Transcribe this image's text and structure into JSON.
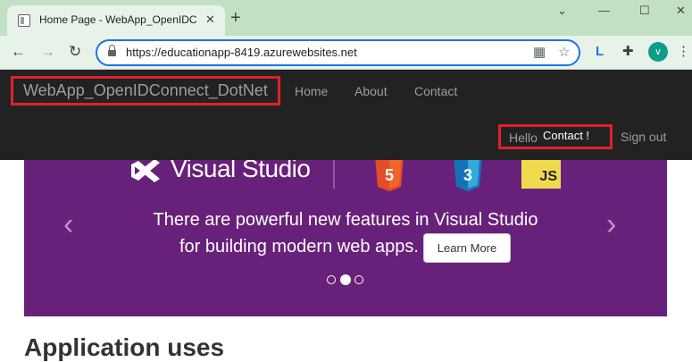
{
  "browser": {
    "tab_title": "Home Page - WebApp_OpenIDC",
    "tab_close": "✕",
    "new_tab": "+",
    "window_controls": {
      "minimize": "—",
      "maximize": "☐",
      "close": "✕",
      "collapse": "⌄"
    },
    "back": "←",
    "forward": "→",
    "reload": "↻",
    "url": "https://educationapp-8419.azurewebsites.net",
    "profile_initial": "v",
    "icons": [
      "page-favicon-icon",
      "lock-icon",
      "qr-code-icon",
      "star-icon",
      "extension-l-icon",
      "puzzle-icon",
      "profile-avatar"
    ]
  },
  "site": {
    "brand": "WebApp_OpenIDConnect_DotNet",
    "nav": [
      "Home",
      "About",
      "Contact"
    ],
    "greeting": "Hello",
    "user_name": "Contact !",
    "sign_out": "Sign out"
  },
  "carousel": {
    "logo_text": "Visual Studio",
    "html5_label": "5",
    "css3_label": "3",
    "js_label": "JS",
    "prev": "‹",
    "next": "›",
    "line1": "There are powerful new features in Visual Studio",
    "line2": "for building modern web apps.",
    "button": "Learn More",
    "active_slide": 2,
    "slide_count": 3
  },
  "content": {
    "heading": "Application uses"
  },
  "colors": {
    "navbar_bg": "#222222",
    "carousel_bg": "#68217a",
    "highlight": "#e0202a",
    "chrome_green": "#c2e1c4"
  }
}
